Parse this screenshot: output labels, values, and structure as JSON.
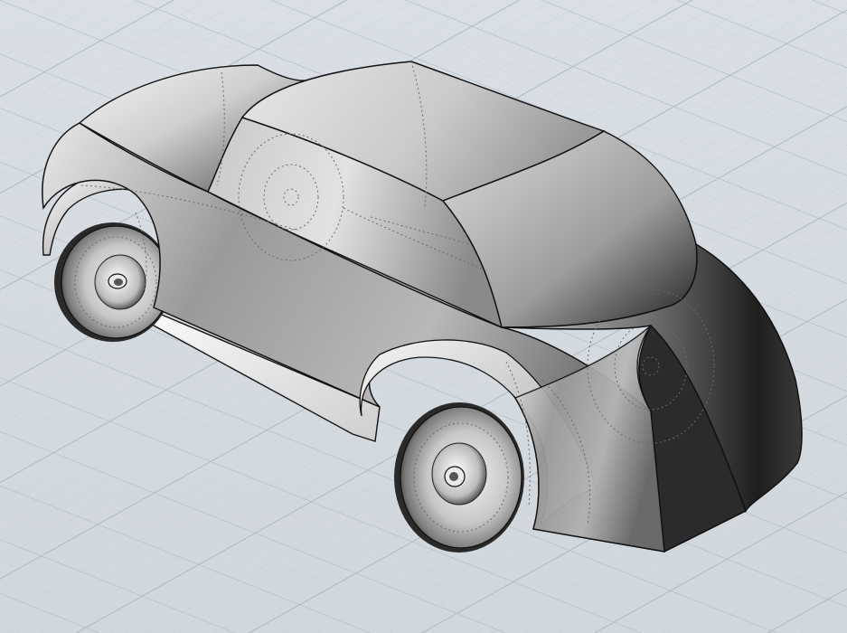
{
  "viewport": {
    "view_type": "Perspective",
    "display_mode": "Shaded",
    "background_color": "#d4dbe1",
    "grid_minor_color": "#bcc6ce",
    "grid_major_color": "#a9b4bd",
    "model_edge_color": "#111111",
    "hidden_line_color": "#6b6b6b"
  },
  "model": {
    "object": "car-body",
    "parts": [
      "body",
      "cabin",
      "roof",
      "windshield",
      "trunk",
      "front-fender",
      "rear-fender",
      "front-wheel",
      "rear-wheel",
      "side-skirt"
    ]
  }
}
